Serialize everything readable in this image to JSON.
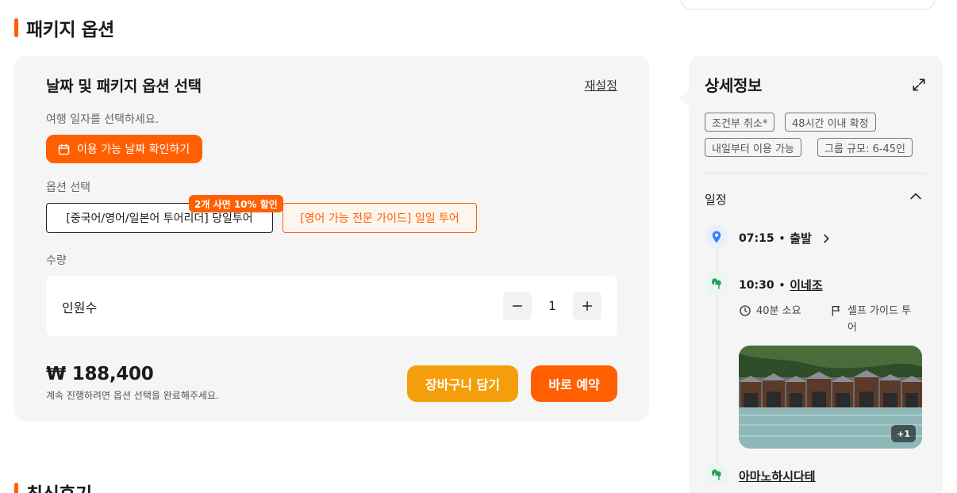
{
  "package_section": {
    "title": "패키지 옵션",
    "heading": "날짜 및 패키지 옵션 선택",
    "reset_label": "재설정",
    "date_label": "여행 일자를 선택하세요.",
    "date_button_label": "이용 가능 날짜 확인하기",
    "option_label": "옵션 선택",
    "options": [
      {
        "label": "[중국어/영어/일본어 투어리더] 당일투어",
        "state": "selected"
      },
      {
        "label": "[영어 가능 전문 가이드] 일일 투어",
        "state": "highlighted"
      }
    ],
    "promo_badge": "2개 사면 10% 할인",
    "quantity_label": "수량",
    "quantity_row_label": "인원수",
    "quantity_value": "1",
    "price": "₩ 188,400",
    "price_note": "계속 진행하려면 옵션 선택을 완료해주세요.",
    "cart_button": "장바구니 담기",
    "book_button": "바로 예약"
  },
  "reviews_section": {
    "title": "최신후기"
  },
  "detail": {
    "title": "상세정보",
    "tags": [
      "조건부 취소*",
      "48시간 이내 확정",
      "내일부터 이용 가능",
      "그룹 규모: 6-45인"
    ],
    "schedule_title": "일정",
    "items": [
      {
        "time": "07:15",
        "name": "출발"
      },
      {
        "time": "10:30",
        "name": "이네조",
        "duration": "40분 소요",
        "guide": "셀프 가이드 투어",
        "photo_more": "+1"
      },
      {
        "name": "아마노하시다테"
      }
    ]
  },
  "colors": {
    "accent": "#ff5f00",
    "cart": "#f59e0b",
    "card_bg": "#f5f5f5",
    "location_pin": "#3b82f6",
    "tree": "#22a35a"
  }
}
